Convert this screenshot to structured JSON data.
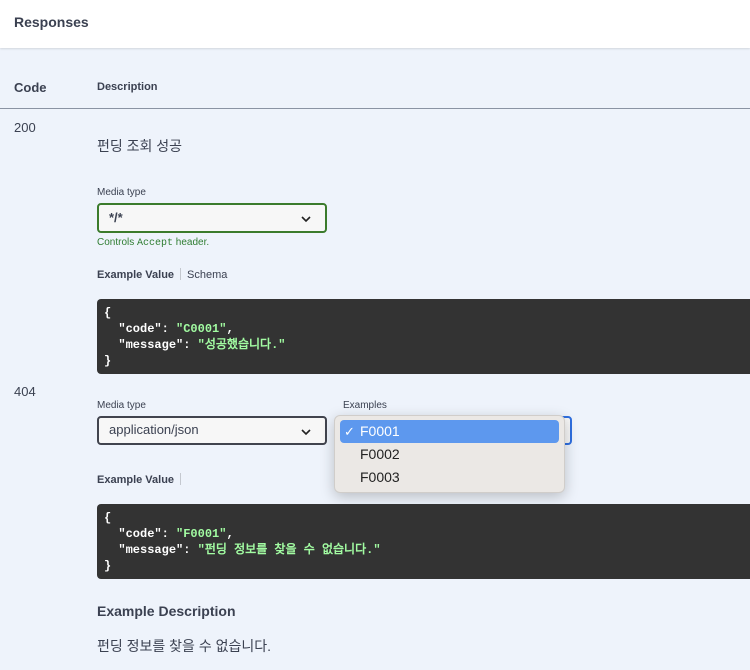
{
  "header": {
    "title": "Responses"
  },
  "columns": {
    "code": "Code",
    "description": "Description"
  },
  "responses": [
    {
      "code": "200",
      "description": "펀딩 조회 성공",
      "media_type_label": "Media type",
      "media_type_value": "*/*",
      "controls_note_prefix": "Controls ",
      "controls_note_code": "Accept",
      "controls_note_suffix": " header.",
      "tabs": {
        "example_value": "Example Value",
        "schema": "Schema"
      },
      "example": {
        "open": "{",
        "code_key": "\"code\"",
        "code_val": "\"C0001\"",
        "message_key": "\"message\"",
        "message_val": "\"성공했습니다.\"",
        "close": "}"
      }
    },
    {
      "code": "404",
      "media_type_label": "Media type",
      "media_type_value": "application/json",
      "examples_label": "Examples",
      "examples_options": [
        "F0001",
        "F0002",
        "F0003"
      ],
      "examples_selected": "F0001",
      "check_mark": "✓",
      "tabs": {
        "example_value": "Example Value"
      },
      "example": {
        "open": "{",
        "code_key": "\"code\"",
        "code_val": "\"F0001\"",
        "message_key": "\"message\"",
        "message_val": "\"펀딩 정보를 찾을 수 없습니다.\"",
        "close": "}"
      },
      "example_description_title": "Example Description",
      "example_description_text": "펀딩 정보를 찾을 수 없습니다."
    }
  ],
  "colors": {
    "background": "#eef3fb",
    "code_bg": "#333333",
    "string": "#a2fca2",
    "valid_border": "#3b7b2c",
    "menu_highlight": "#5d98ee"
  },
  "icons": {
    "select_arrow": "chevron-down-icon",
    "check": "checkmark-icon"
  }
}
